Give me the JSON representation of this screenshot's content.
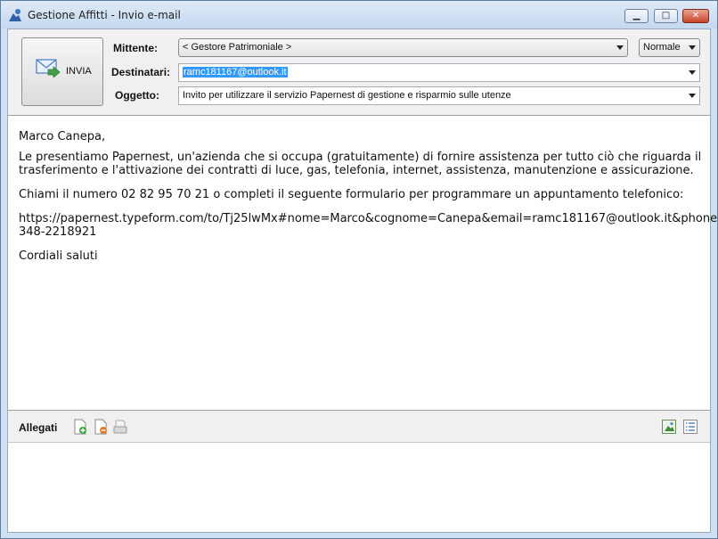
{
  "window": {
    "title": "Gestione Affitti - Invio e-mail"
  },
  "toolbar": {
    "send_label": "INVIA"
  },
  "fields": {
    "mittente_label": "Mittente:",
    "mittente_value": "< Gestore Patrimoniale >",
    "priority_value": "Normale",
    "destinatari_label": "Destinatari:",
    "destinatari_value": "ramc181167@outlook.it",
    "oggetto_label": "Oggetto:",
    "oggetto_value": "Invito per utilizzare il servizio Papernest di gestione e risparmio sulle utenze"
  },
  "message": {
    "greeting": "Marco Canepa,",
    "para1_line1": "Le presentiamo Papernest, un'azienda che si occupa (gratuitamente) di fornire assistenza per tutto ciò che riguarda il",
    "para1_line2": "trasferimento e l'attivazione dei contratti di luce, gas, telefonia, internet, assistenza, manutenzione e assicurazione.",
    "para2": "Chiami il numero 02 82 95 70 21 o completi il seguente formulario per programmare un appuntamento telefonico:",
    "link_line1": "https://papernest.typeform.com/to/Tj25lwMx#nome=Marco&cognome=Canepa&email=ramc181167@outlook.it&phone=",
    "link_line2": "348-2218921",
    "closing": "Cordiali saluti"
  },
  "attachments": {
    "label": "Allegati"
  },
  "icons": {
    "app": "app-icon",
    "send": "envelope-send-icon",
    "add": "add-attachment-icon",
    "remove": "remove-attachment-icon",
    "scan": "scan-icon",
    "view_image": "image-view-icon",
    "view_list": "list-view-icon"
  },
  "colors": {
    "selection": "#3399ff",
    "titlebar": "#c4d8ef",
    "panel": "#f0f0f0"
  }
}
